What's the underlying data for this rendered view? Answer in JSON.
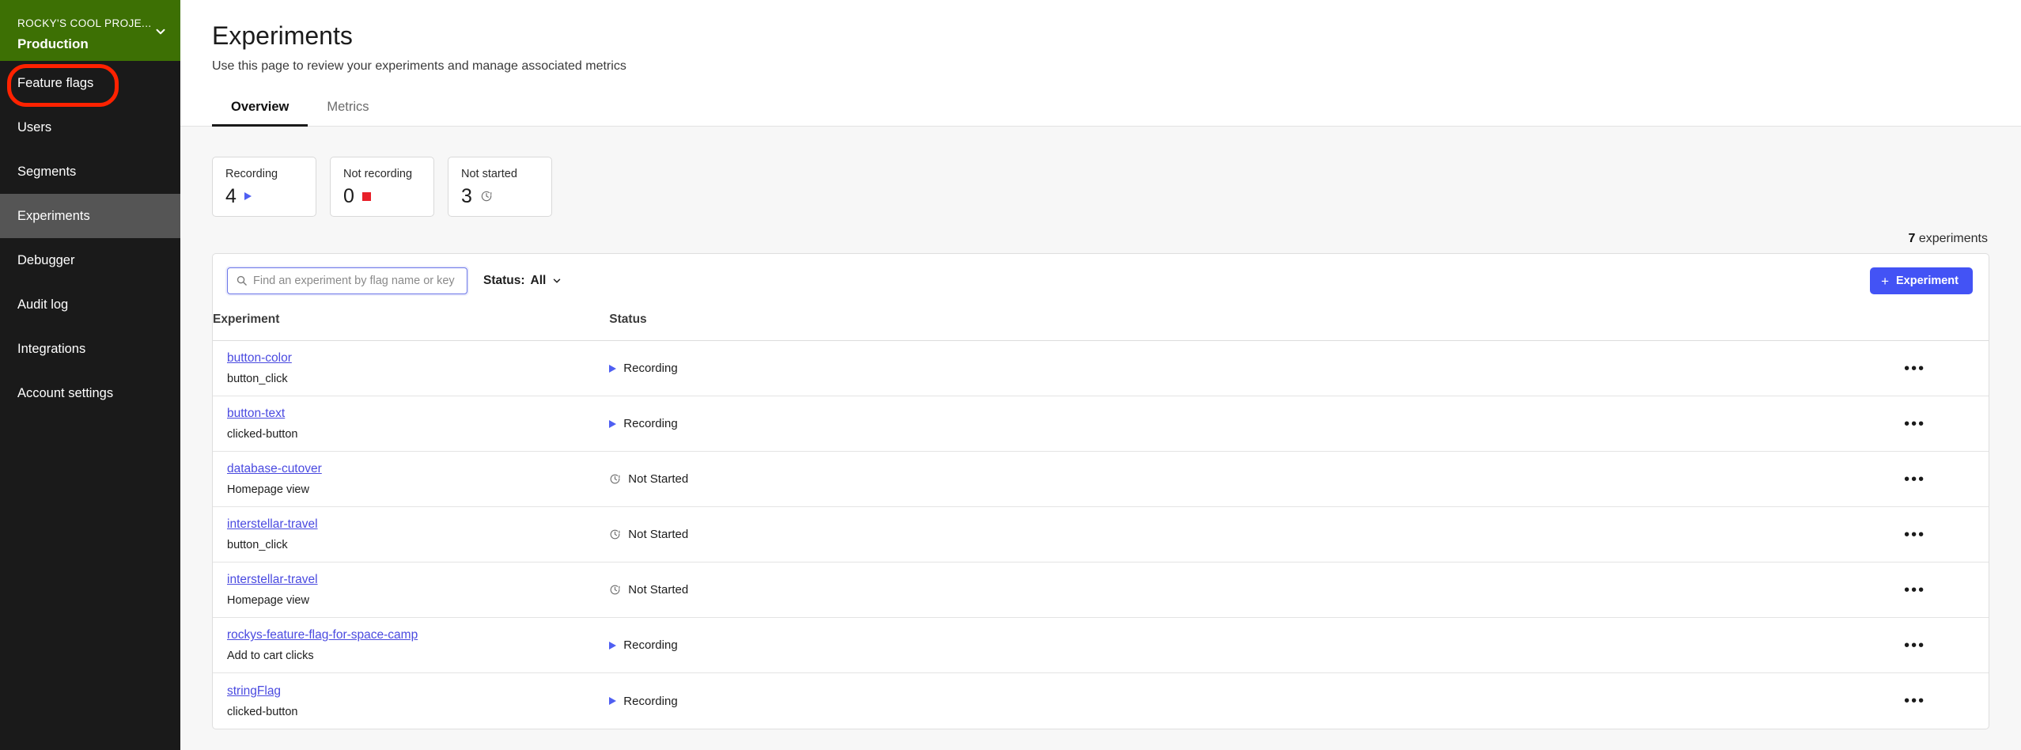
{
  "sidebar": {
    "project": {
      "name": "ROCKY'S COOL PROJE...",
      "environment": "Production",
      "chevron_icon": "chevron-down-icon",
      "background_color": "#3d7004"
    },
    "items": [
      {
        "label": "Feature flags",
        "active": false,
        "annotated": true
      },
      {
        "label": "Users",
        "active": false,
        "annotated": false
      },
      {
        "label": "Segments",
        "active": false,
        "annotated": false
      },
      {
        "label": "Experiments",
        "active": true,
        "annotated": false
      },
      {
        "label": "Debugger",
        "active": false,
        "annotated": false
      },
      {
        "label": "Audit log",
        "active": false,
        "annotated": false
      },
      {
        "label": "Integrations",
        "active": false,
        "annotated": false
      },
      {
        "label": "Account settings",
        "active": false,
        "annotated": false
      }
    ],
    "annotation_color": "#ff2200"
  },
  "header": {
    "title": "Experiments",
    "subtitle": "Use this page to review your experiments and manage associated metrics"
  },
  "tabs": [
    {
      "label": "Overview",
      "active": true
    },
    {
      "label": "Metrics",
      "active": false
    }
  ],
  "stats": [
    {
      "label": "Recording",
      "value": "4",
      "icon": "play-icon",
      "color": "#4f5ff2"
    },
    {
      "label": "Not recording",
      "value": "0",
      "icon": "stop-square-icon",
      "color": "#e8202a"
    },
    {
      "label": "Not started",
      "value": "3",
      "icon": "clock-alert-icon",
      "color": "#6c6c6c"
    }
  ],
  "count": {
    "number": "7",
    "label": "experiments"
  },
  "toolbar": {
    "search": {
      "placeholder": "Find an experiment by flag name or key",
      "value": "",
      "icon": "search-icon"
    },
    "status_filter": {
      "label": "Status:",
      "value": "All",
      "icon": "chevron-down-icon"
    },
    "create_button": {
      "label": "Experiment",
      "plus": "+",
      "color": "#4353f5"
    }
  },
  "table": {
    "columns": [
      "Experiment",
      "Status",
      ""
    ],
    "rows": [
      {
        "name": "button-color",
        "metric": "button_click",
        "status": "Recording",
        "status_icon": "play-icon",
        "menu_icon": "overflow-menu-icon"
      },
      {
        "name": "button-text",
        "metric": "clicked-button",
        "status": "Recording",
        "status_icon": "play-icon",
        "menu_icon": "overflow-menu-icon"
      },
      {
        "name": "database-cutover",
        "metric": "Homepage view",
        "status": "Not Started",
        "status_icon": "clock-alert-icon",
        "menu_icon": "overflow-menu-icon"
      },
      {
        "name": "interstellar-travel",
        "metric": "button_click",
        "status": "Not Started",
        "status_icon": "clock-alert-icon",
        "menu_icon": "overflow-menu-icon"
      },
      {
        "name": "interstellar-travel",
        "metric": "Homepage view",
        "status": "Not Started",
        "status_icon": "clock-alert-icon",
        "menu_icon": "overflow-menu-icon"
      },
      {
        "name": "rockys-feature-flag-for-space-camp",
        "metric": "Add to cart clicks",
        "status": "Recording",
        "status_icon": "play-icon",
        "menu_icon": "overflow-menu-icon"
      },
      {
        "name": "stringFlag",
        "metric": "clicked-button",
        "status": "Recording",
        "status_icon": "play-icon",
        "menu_icon": "overflow-menu-icon"
      }
    ],
    "menu_glyph": "•••"
  }
}
